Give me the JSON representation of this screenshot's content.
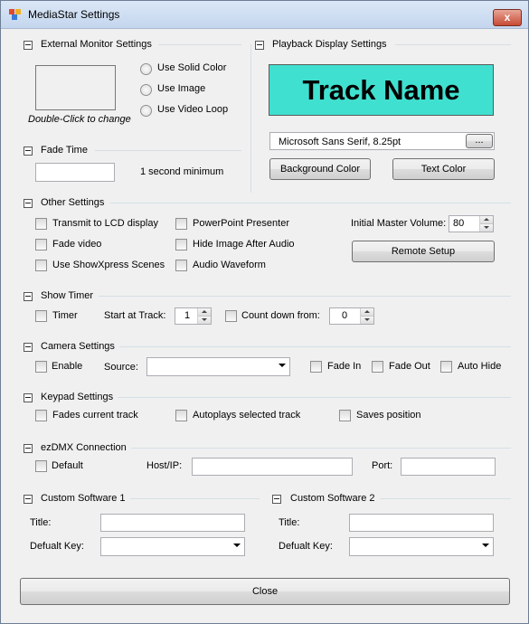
{
  "window": {
    "title": "MediaStar Settings",
    "close_glyph": "x"
  },
  "external_monitor": {
    "title": "External Monitor Settings",
    "preview_caption": "Double-Click to change",
    "radios": [
      "Use Solid Color",
      "Use Image",
      "Use Video Loop"
    ]
  },
  "playback_display": {
    "title": "Playback Display Settings",
    "preview_text": "Track Name",
    "preview_bg": "#40e0d0",
    "font_value": "Microsoft Sans Serif, 8.25pt",
    "font_browse": "...",
    "background_color_button": "Background Color",
    "text_color_button": "Text Color"
  },
  "fade_time": {
    "title": "Fade Time",
    "value": "",
    "hint": "1 second minimum"
  },
  "other_settings": {
    "title": "Other Settings",
    "checks_col1": [
      "Transmit to LCD display",
      "Fade video",
      "Use ShowXpress Scenes"
    ],
    "checks_col2": [
      "PowerPoint Presenter",
      "Hide Image After Audio",
      "Audio Waveform"
    ],
    "volume_label": "Initial Master Volume:",
    "volume_value": "80",
    "remote_setup_button": "Remote Setup"
  },
  "show_timer": {
    "title": "Show Timer",
    "timer_label": "Timer",
    "start_label": "Start at Track:",
    "start_value": "1",
    "count_label": "Count down from:",
    "count_value": "0"
  },
  "camera": {
    "title": "Camera Settings",
    "enable_label": "Enable",
    "source_label": "Source:",
    "source_value": "",
    "fade_in_label": "Fade In",
    "fade_out_label": "Fade Out",
    "auto_hide_label": "Auto Hide"
  },
  "keypad": {
    "title": "Keypad Settings",
    "checks": [
      "Fades current track",
      "Autoplays selected track",
      "Saves position"
    ]
  },
  "ezdmx": {
    "title": "ezDMX Connection",
    "default_label": "Default",
    "host_label": "Host/IP:",
    "host_value": "",
    "port_label": "Port:",
    "port_value": ""
  },
  "custom1": {
    "title": "Custom Software 1",
    "title_label": "Title:",
    "title_value": "",
    "key_label": "Defualt Key:",
    "key_value": ""
  },
  "custom2": {
    "title": "Custom Software 2",
    "title_label": "Title:",
    "title_value": "",
    "key_label": "Defualt Key:",
    "key_value": ""
  },
  "close_button": "Close"
}
